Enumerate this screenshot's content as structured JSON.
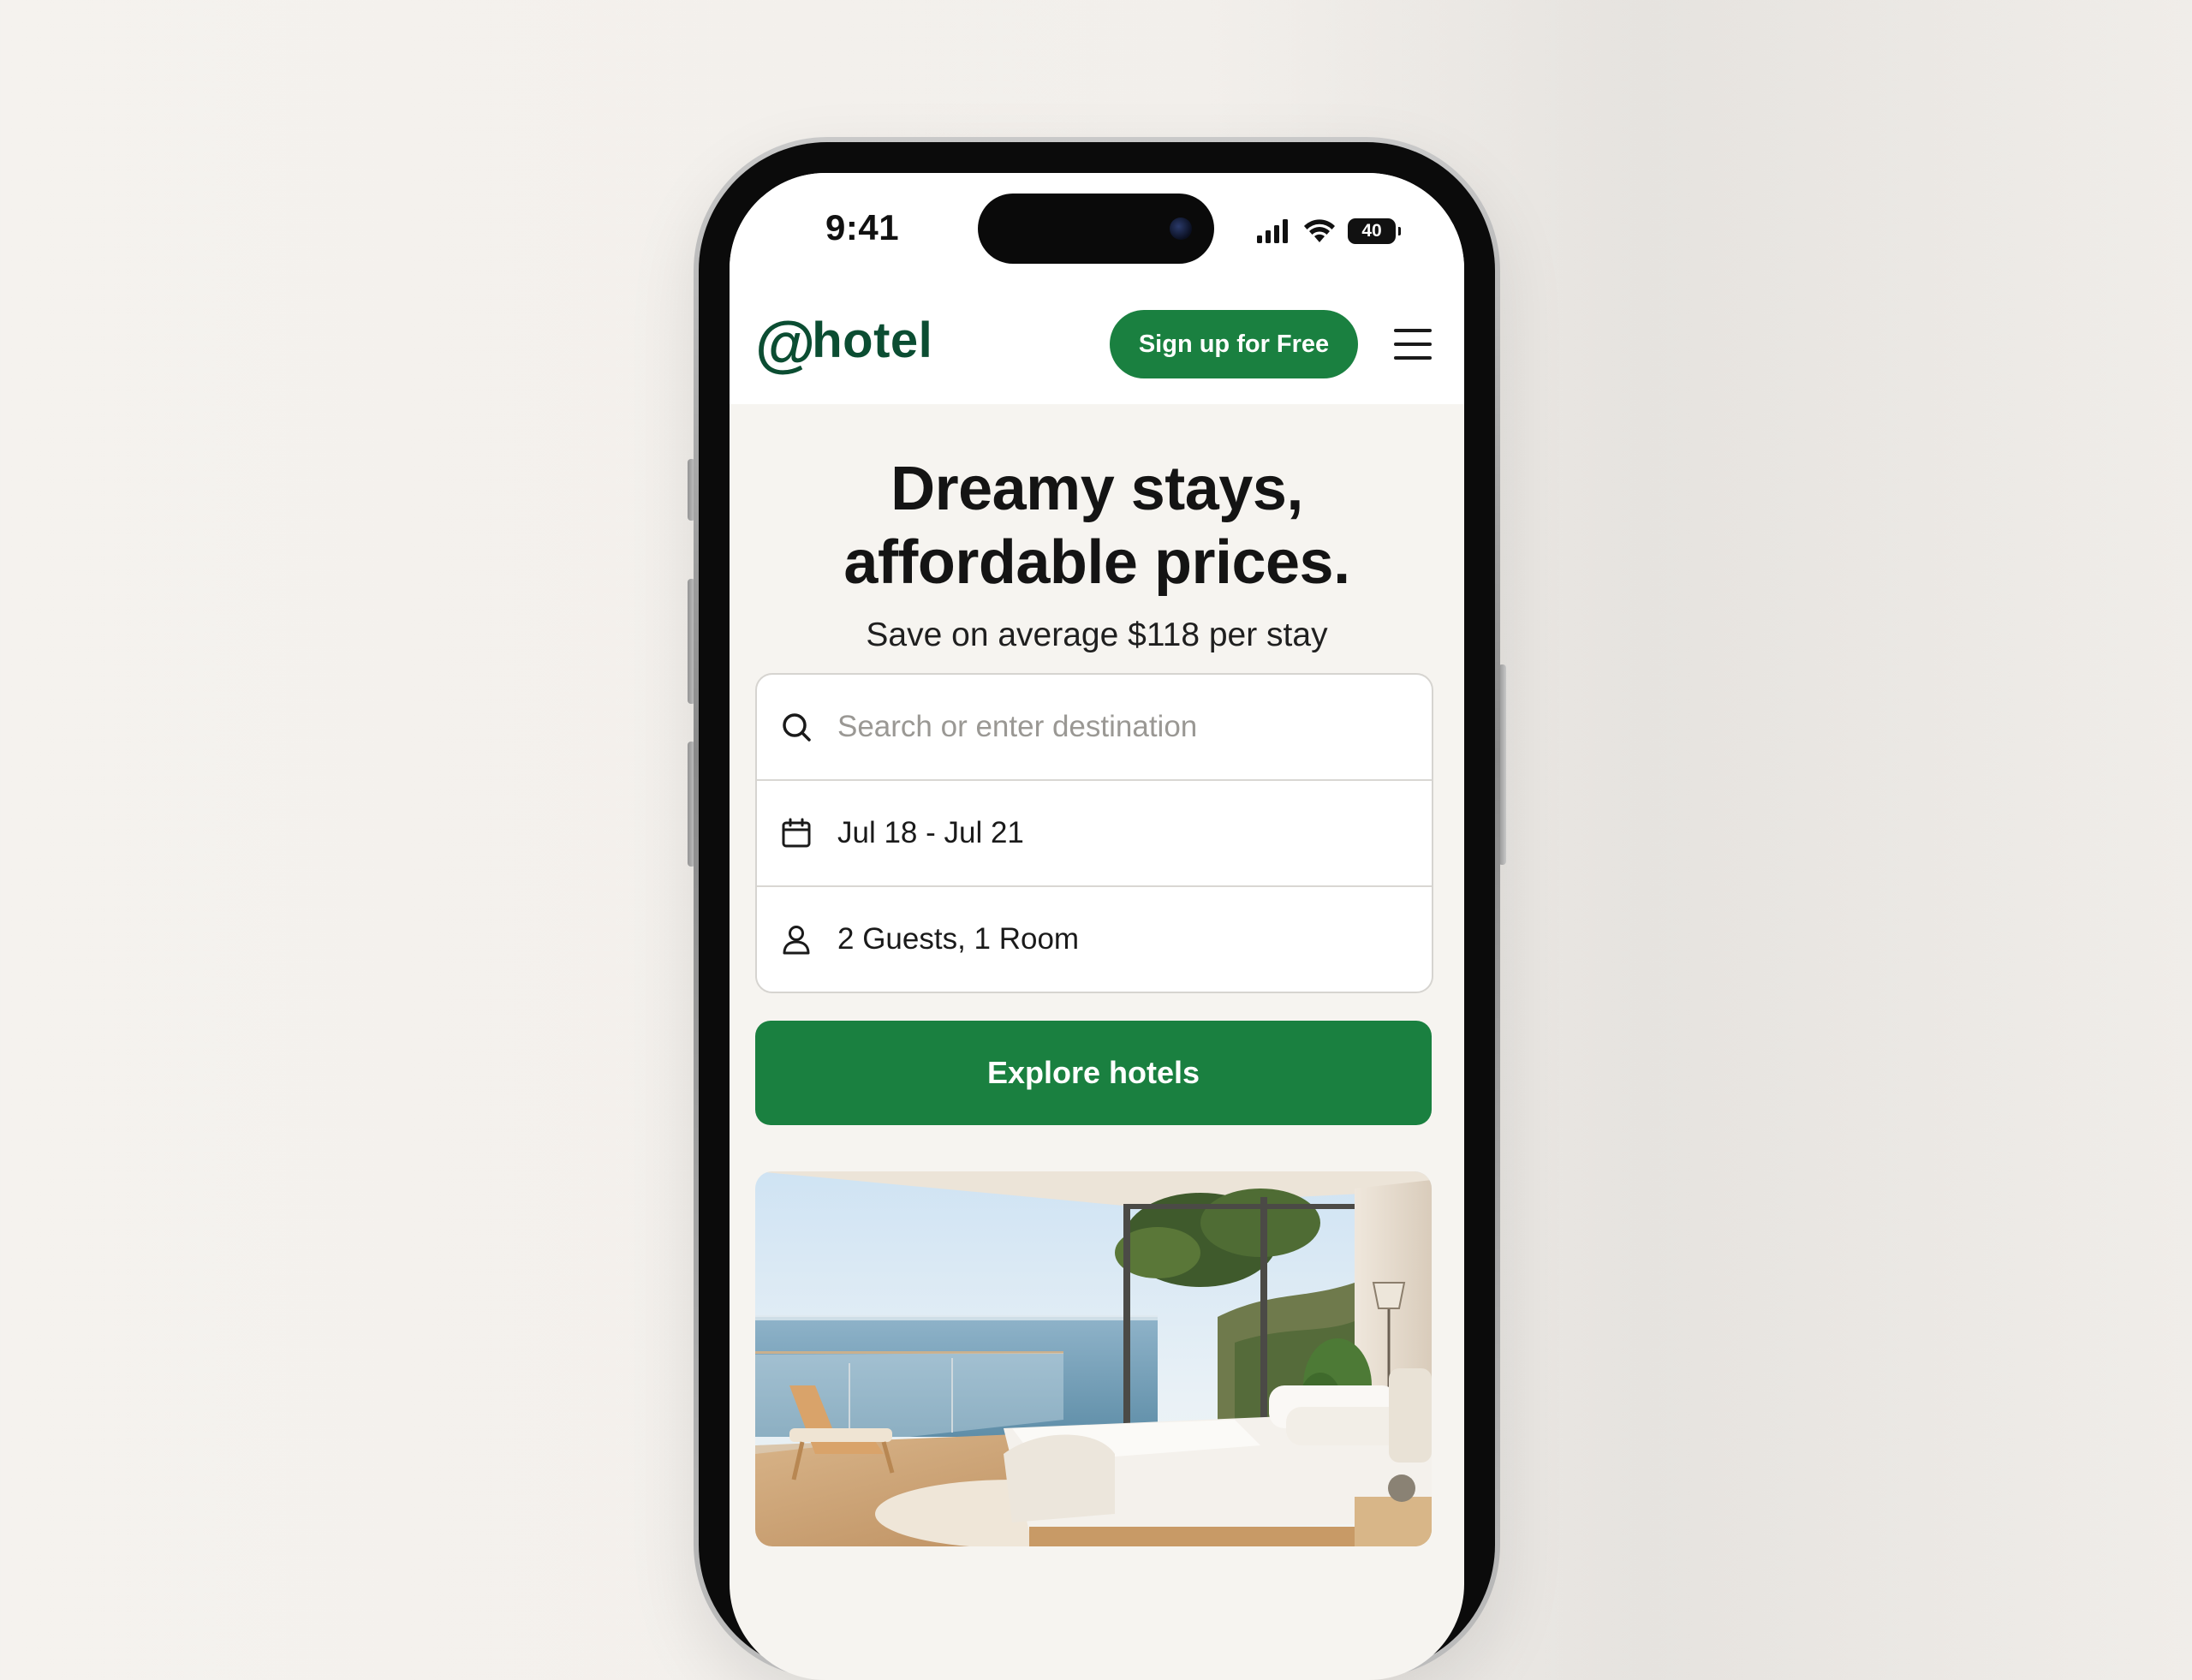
{
  "status_bar": {
    "time": "9:41",
    "battery": "40"
  },
  "header": {
    "logo_prefix": "@",
    "logo_text": "hotel",
    "signup_label": "Sign up for Free",
    "menu_icon": "hamburger-menu-icon"
  },
  "hero": {
    "title_line1": "Dreamy stays,",
    "title_line2": "affordable prices.",
    "subtitle": "Save on average $118 per stay"
  },
  "search": {
    "placeholder": "Search or enter destination",
    "dates": "Jul 18 - Jul 21",
    "guests": "2 Guests, 1 Room",
    "icons": {
      "search": "search-icon",
      "dates": "calendar-icon",
      "guests": "person-icon"
    }
  },
  "cta": {
    "explore_label": "Explore hotels"
  },
  "colors": {
    "brand_green": "#1a8040",
    "logo_green": "#0b4d32",
    "page_bg": "#f6f4f0"
  }
}
